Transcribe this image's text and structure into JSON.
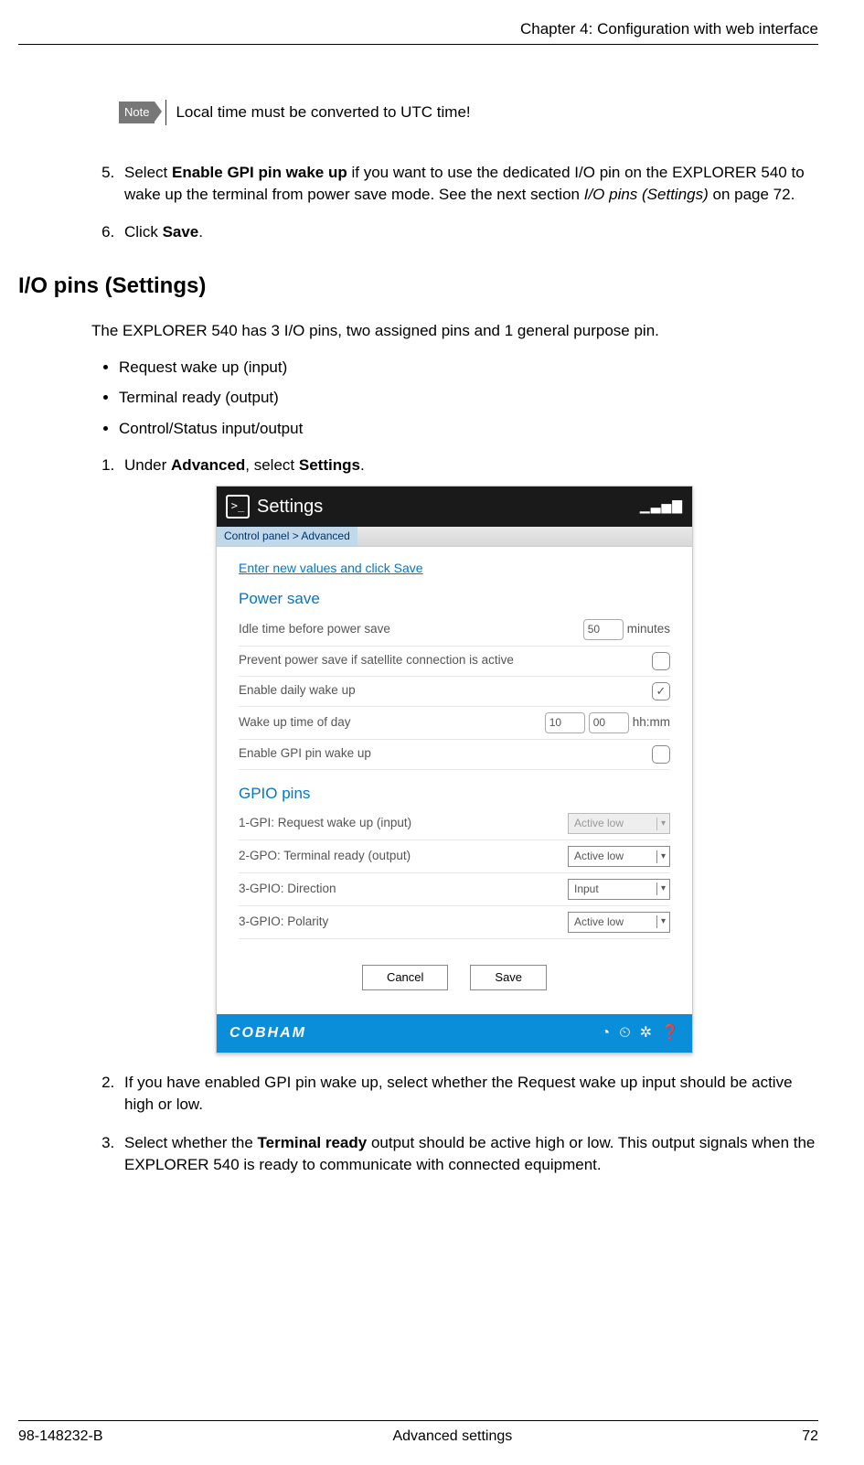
{
  "header": "Chapter 4: Configuration with web interface",
  "note": {
    "tag": "Note",
    "text": "Local time must be converted to UTC time!"
  },
  "step5": {
    "pre": "Select ",
    "bold": "Enable GPI pin wake up",
    "mid": " if you want to use the dedicated I/O pin on the EXPLORER 540 to wake up the terminal from power save mode. See the next section ",
    "italic": "I/O pins (Settings)",
    "post": " on page 72."
  },
  "step6": {
    "pre": "Click ",
    "bold": "Save",
    "post": "."
  },
  "h2": "I/O pins (Settings)",
  "intro": "The EXPLORER 540 has 3 I/O pins, two assigned pins and 1 general purpose pin.",
  "pins": [
    "Request wake up (input)",
    "Terminal ready (output)",
    "Control/Status input/output"
  ],
  "step1": {
    "pre": "Under ",
    "bold1": "Advanced",
    "mid": ", select ",
    "bold2": "Settings",
    "post": "."
  },
  "ui": {
    "title": "Settings",
    "breadcrumb": "Control panel > Advanced",
    "hint": "Enter new values and click Save",
    "powersave": {
      "title": "Power save",
      "idle_label": "Idle time before power save",
      "idle_value": "50",
      "idle_unit": "minutes",
      "prevent_label": "Prevent power save if satellite connection is active",
      "daily_label": "Enable daily wake up",
      "daily_checked": "✓",
      "wake_label": "Wake up time of day",
      "wake_hh": "10",
      "wake_mm": "00",
      "wake_unit": "hh:mm",
      "gpi_label": "Enable GPI pin wake up"
    },
    "gpio": {
      "title": "GPIO pins",
      "row1_label": "1-GPI: Request wake up (input)",
      "row1_value": "Active low",
      "row2_label": "2-GPO: Terminal ready (output)",
      "row2_value": "Active low",
      "row3_label": "3-GPIO: Direction",
      "row3_value": "Input",
      "row4_label": "3-GPIO: Polarity",
      "row4_value": "Active low"
    },
    "cancel": "Cancel",
    "save": "Save",
    "brand": "COBHAM"
  },
  "step2": "If you have enabled GPI pin wake up, select whether the Request wake up input should be active high or low.",
  "step3": {
    "pre": "Select whether the ",
    "bold": "Terminal ready",
    "post": " output should be active high or low. This output signals when the EXPLORER 540 is ready to communicate with connected equipment."
  },
  "footer": {
    "left": "98-148232-B",
    "center": "Advanced settings",
    "right": "72"
  }
}
